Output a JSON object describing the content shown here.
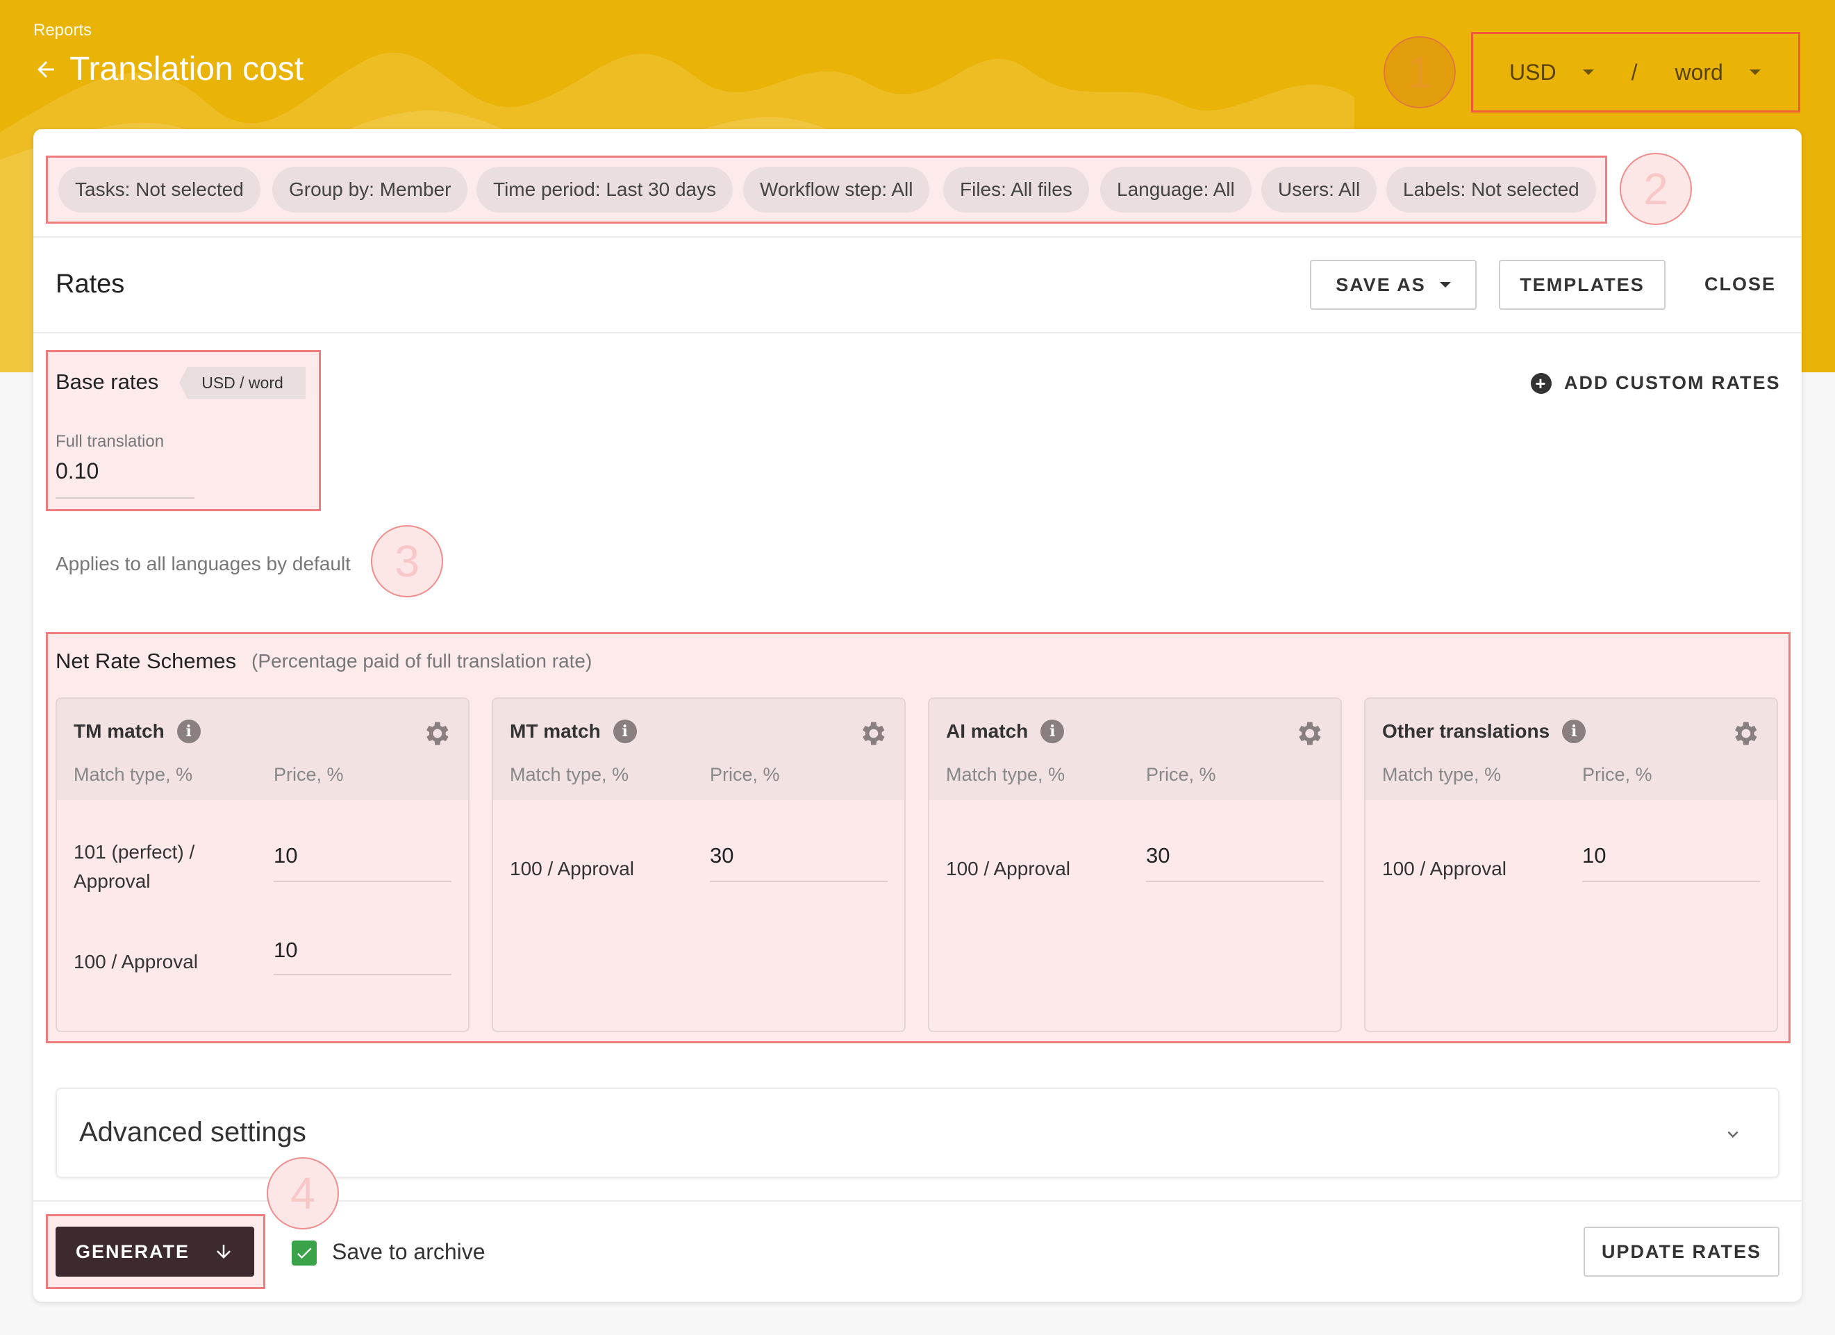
{
  "header": {
    "breadcrumb": "Reports",
    "title": "Translation cost",
    "currency": "USD",
    "separator": "/",
    "unit": "word",
    "accent_color": "#eab308"
  },
  "markers": [
    "1",
    "2",
    "3",
    "4"
  ],
  "filters": [
    "Tasks: Not selected",
    "Group by: Member",
    "Time period: Last 30 days",
    "Workflow step: All",
    "Files: All files",
    "Language: All",
    "Users: All",
    "Labels: Not selected"
  ],
  "rates": {
    "title": "Rates",
    "save_as": "SAVE AS",
    "templates": "TEMPLATES",
    "close": "CLOSE"
  },
  "base_rates": {
    "title": "Base rates",
    "unit_tag": "USD / word",
    "field_label": "Full translation",
    "field_value": "0.10",
    "applies_text": "Applies to all languages by default",
    "add_custom": "ADD CUSTOM RATES"
  },
  "net_rates": {
    "title": "Net Rate Schemes",
    "subtitle": "(Percentage paid of full translation rate)",
    "col_match": "Match type, %",
    "col_price": "Price, %",
    "schemes": [
      {
        "title": "TM match",
        "rows": [
          {
            "label": "101 (perfect) / Approval",
            "value": "10"
          },
          {
            "label": "100 / Approval",
            "value": "10"
          }
        ]
      },
      {
        "title": "MT match",
        "rows": [
          {
            "label": "100 / Approval",
            "value": "30"
          }
        ]
      },
      {
        "title": "AI match",
        "rows": [
          {
            "label": "100 / Approval",
            "value": "30"
          }
        ]
      },
      {
        "title": "Other translations",
        "rows": [
          {
            "label": "100 / Approval",
            "value": "10"
          }
        ]
      }
    ]
  },
  "advanced": {
    "title": "Advanced settings"
  },
  "footer": {
    "generate": "GENERATE",
    "save_archive": "Save to archive",
    "save_archive_checked": true,
    "update_rates": "UPDATE RATES"
  }
}
